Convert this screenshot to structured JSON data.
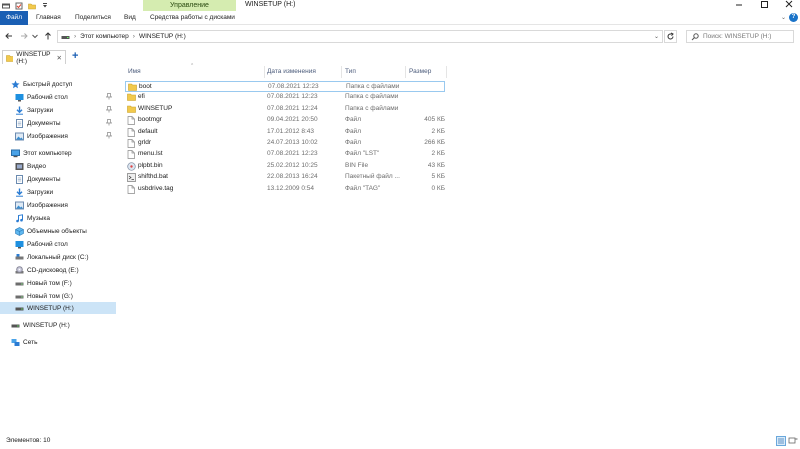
{
  "window": {
    "title": "WINSETUP (H:)",
    "manage_label": "Управление"
  },
  "ribbon": {
    "tabs": [
      "Файл",
      "Главная",
      "Поделиться",
      "Вид",
      "Средства работы с дисками"
    ]
  },
  "address": {
    "parts": [
      "Этот компьютер",
      "WINSETUP (H:)"
    ],
    "search_placeholder": "Поиск: WINSETUP (H:)"
  },
  "tab": {
    "label": "WINSETUP (H:)"
  },
  "sidebar": {
    "items": [
      {
        "label": "Быстрый доступ",
        "icon": "star-icon",
        "level": 0,
        "pinned": false
      },
      {
        "label": "Рабочий стол",
        "icon": "desktop-icon",
        "level": 1,
        "pinned": true
      },
      {
        "label": "Загрузки",
        "icon": "download-icon",
        "level": 1,
        "pinned": true
      },
      {
        "label": "Документы",
        "icon": "documents-icon",
        "level": 1,
        "pinned": true
      },
      {
        "label": "Изображения",
        "icon": "pictures-icon",
        "level": 1,
        "pinned": true
      },
      {
        "label": "Этот компьютер",
        "icon": "computer-icon",
        "level": 0,
        "pinned": false
      },
      {
        "label": "Видео",
        "icon": "video-icon",
        "level": 1,
        "pinned": false
      },
      {
        "label": "Документы",
        "icon": "documents-icon",
        "level": 1,
        "pinned": false
      },
      {
        "label": "Загрузки",
        "icon": "download-icon",
        "level": 1,
        "pinned": false
      },
      {
        "label": "Изображения",
        "icon": "pictures-icon",
        "level": 1,
        "pinned": false
      },
      {
        "label": "Музыка",
        "icon": "music-icon",
        "level": 1,
        "pinned": false
      },
      {
        "label": "Объемные объекты",
        "icon": "3d-objects-icon",
        "level": 1,
        "pinned": false
      },
      {
        "label": "Рабочий стол",
        "icon": "desktop-icon",
        "level": 1,
        "pinned": false
      },
      {
        "label": "Локальный диск (C:)",
        "icon": "local-disk-icon",
        "level": 1,
        "pinned": false
      },
      {
        "label": "CD-дисковод (E:)",
        "icon": "cd-drive-icon",
        "level": 1,
        "pinned": false
      },
      {
        "label": "Новый том (F:)",
        "icon": "drive-icon",
        "level": 1,
        "pinned": false
      },
      {
        "label": "Новый том (G:)",
        "icon": "drive-icon",
        "level": 1,
        "pinned": false
      },
      {
        "label": "WINSETUP (H:)",
        "icon": "usb-drive-icon",
        "level": 1,
        "pinned": false,
        "selected": true
      },
      {
        "label": "WINSETUP (H:)",
        "icon": "usb-drive-icon",
        "level": 0,
        "pinned": false
      },
      {
        "label": "Сеть",
        "icon": "network-icon",
        "level": 0,
        "pinned": false
      }
    ]
  },
  "columns": [
    "Имя",
    "Дата изменения",
    "Тип",
    "Размер"
  ],
  "files": [
    {
      "name": "boot",
      "date": "07.08.2021 12:23",
      "type": "Папка с файлами",
      "size": "",
      "icon": "folder-icon"
    },
    {
      "name": "efi",
      "date": "07.08.2021 12:23",
      "type": "Папка с файлами",
      "size": "",
      "icon": "folder-icon"
    },
    {
      "name": "WINSETUP",
      "date": "07.08.2021 12:24",
      "type": "Папка с файлами",
      "size": "",
      "icon": "folder-icon"
    },
    {
      "name": "bootmgr",
      "date": "09.04.2021 20:50",
      "type": "Файл",
      "size": "405 КБ",
      "icon": "file-icon"
    },
    {
      "name": "default",
      "date": "17.01.2012 8:43",
      "type": "Файл",
      "size": "2 КБ",
      "icon": "file-icon"
    },
    {
      "name": "grldr",
      "date": "24.07.2013 10:02",
      "type": "Файл",
      "size": "266 КБ",
      "icon": "file-icon"
    },
    {
      "name": "menu.lst",
      "date": "07.08.2021 12:23",
      "type": "Файл \"LST\"",
      "size": "2 КБ",
      "icon": "file-icon"
    },
    {
      "name": "plpbt.bin",
      "date": "25.02.2012 10:25",
      "type": "BIN File",
      "size": "43 КБ",
      "icon": "bin-file-icon"
    },
    {
      "name": "shifthd.bat",
      "date": "22.08.2013 16:24",
      "type": "Пакетный файл ...",
      "size": "5 КБ",
      "icon": "batch-file-icon"
    },
    {
      "name": "usbdrive.tag",
      "date": "13.12.2009 0:54",
      "type": "Файл \"TAG\"",
      "size": "0 КБ",
      "icon": "file-icon"
    }
  ],
  "status": {
    "text": "Элементов: 10"
  },
  "colors": {
    "accent": "#1a5fb4",
    "manage_tab": "#d5ecb0",
    "selection": "#cce4f7",
    "folder": "#f2c94c"
  }
}
